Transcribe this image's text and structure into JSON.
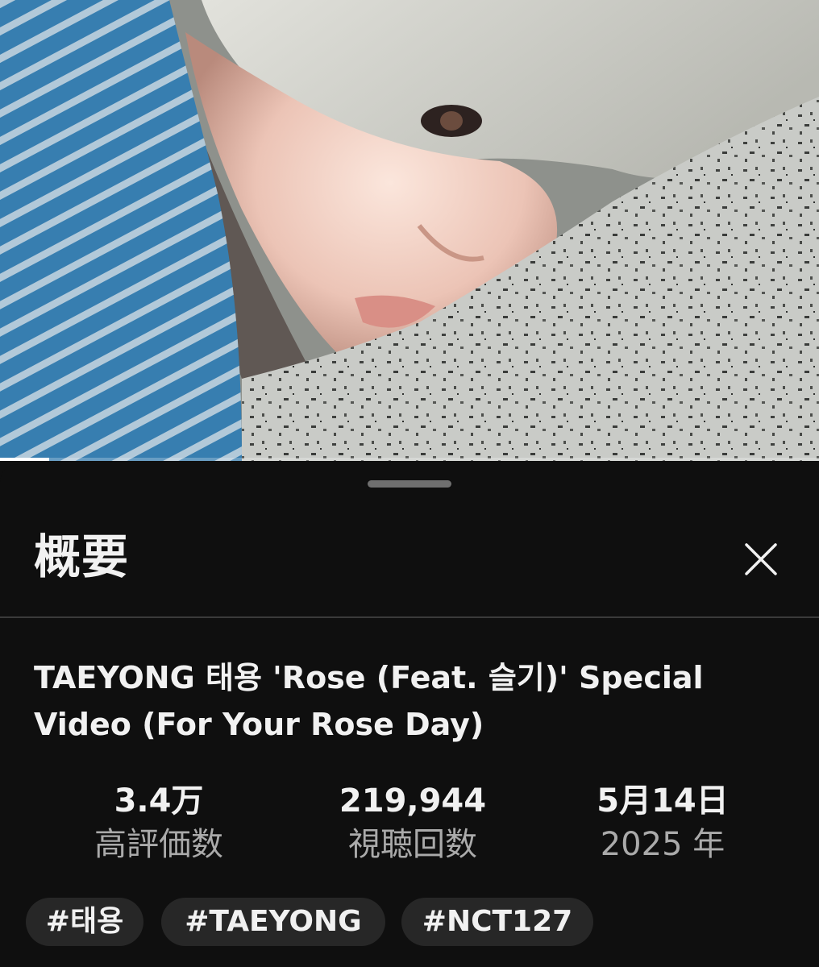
{
  "player": {
    "progress_fraction": 0.06
  },
  "sheet": {
    "title": "概要",
    "close_icon": "close-icon"
  },
  "video": {
    "title": "TAEYONG 태용 'Rose (Feat. 슬기)' Special Video (For Your Rose Day)"
  },
  "stats": [
    {
      "value": "3.4万",
      "label": "高評価数"
    },
    {
      "value": "219,944",
      "label": "視聴回数"
    },
    {
      "value": "5月14日",
      "label": "2025 年"
    }
  ],
  "hashtags": [
    "#태용",
    "#TAEYONG",
    "#NCT127"
  ],
  "colors": {
    "background": "#0f0f0f",
    "chip": "#272727",
    "secondary_text": "#aaaaaa"
  }
}
